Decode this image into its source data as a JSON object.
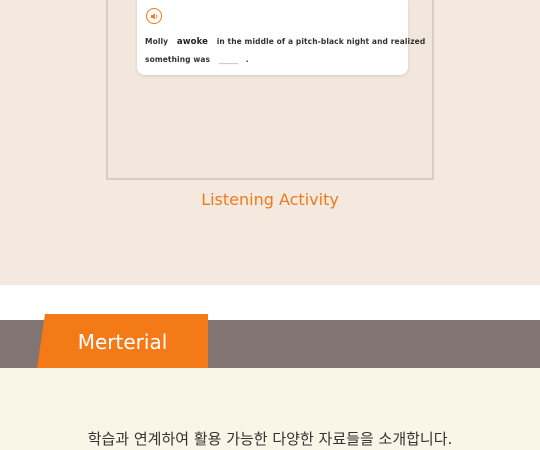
{
  "activity": {
    "line1_before": "Molly",
    "answer_word": "awoke",
    "line1_after": "in the middle of a pitch-black night and realized",
    "line2_before": "something was",
    "blank": "_____",
    "line2_after": "."
  },
  "caption": "Listening Activity",
  "banner": {
    "title": "Merterial"
  },
  "intro": "학습과 연계하여 활용 가능한 다양한 자료들을 소개합니다.",
  "colors": {
    "accent": "#f07a1a",
    "banner": "#817472",
    "top_bg": "#f3e9df",
    "bottom_bg": "#fbf5e8"
  }
}
